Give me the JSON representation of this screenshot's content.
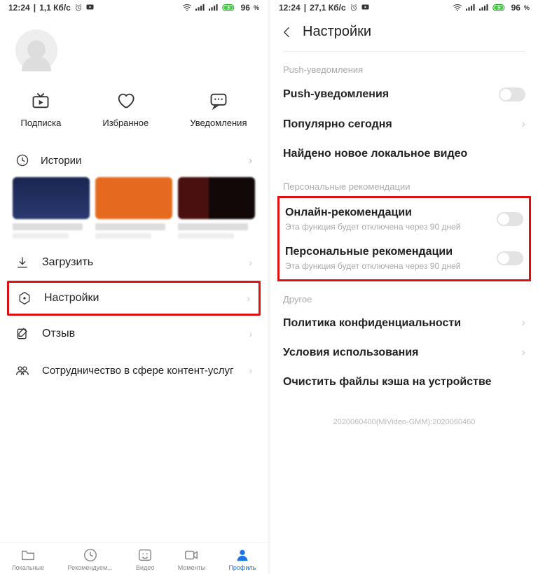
{
  "left": {
    "status": {
      "time": "12:24",
      "rate": "1,1 Кб/с",
      "battery": "96"
    },
    "actions": {
      "sub": "Подписка",
      "fav": "Избранное",
      "notif": "Уведомления"
    },
    "history_label": "Истории",
    "menu": {
      "download": "Загрузить",
      "settings": "Настройки",
      "feedback": "Отзыв",
      "coop": "Сотрудничество в сфере контент-услуг"
    },
    "nav": {
      "local": "Локальные",
      "rec": "Рекомендуем...",
      "video": "Видео",
      "moments": "Моменты",
      "profile": "Профиль"
    }
  },
  "right": {
    "status": {
      "time": "12:24",
      "rate": "27,1 Кб/с",
      "battery": "96"
    },
    "header": "Настройки",
    "groups": {
      "push_label": "Push-уведомления",
      "push": "Push-уведомления",
      "popular": "Популярно сегодня",
      "newlocal": "Найдено новое локальное видео",
      "pers_label": "Персональные рекомендации",
      "online_rec": "Онлайн-рекомендации",
      "online_rec_sub": "Эта функция будет отключена через 90 дней",
      "pers_rec": "Персональные рекомендации",
      "pers_rec_sub": "Эта функция будет отключена через 90 дней",
      "other_label": "Другое",
      "privacy": "Политика конфиденциальности",
      "terms": "Условия использования",
      "cache": "Очистить файлы кэша на устройстве"
    },
    "version": "2020060400(MiVideo-GMM):2020060460"
  }
}
